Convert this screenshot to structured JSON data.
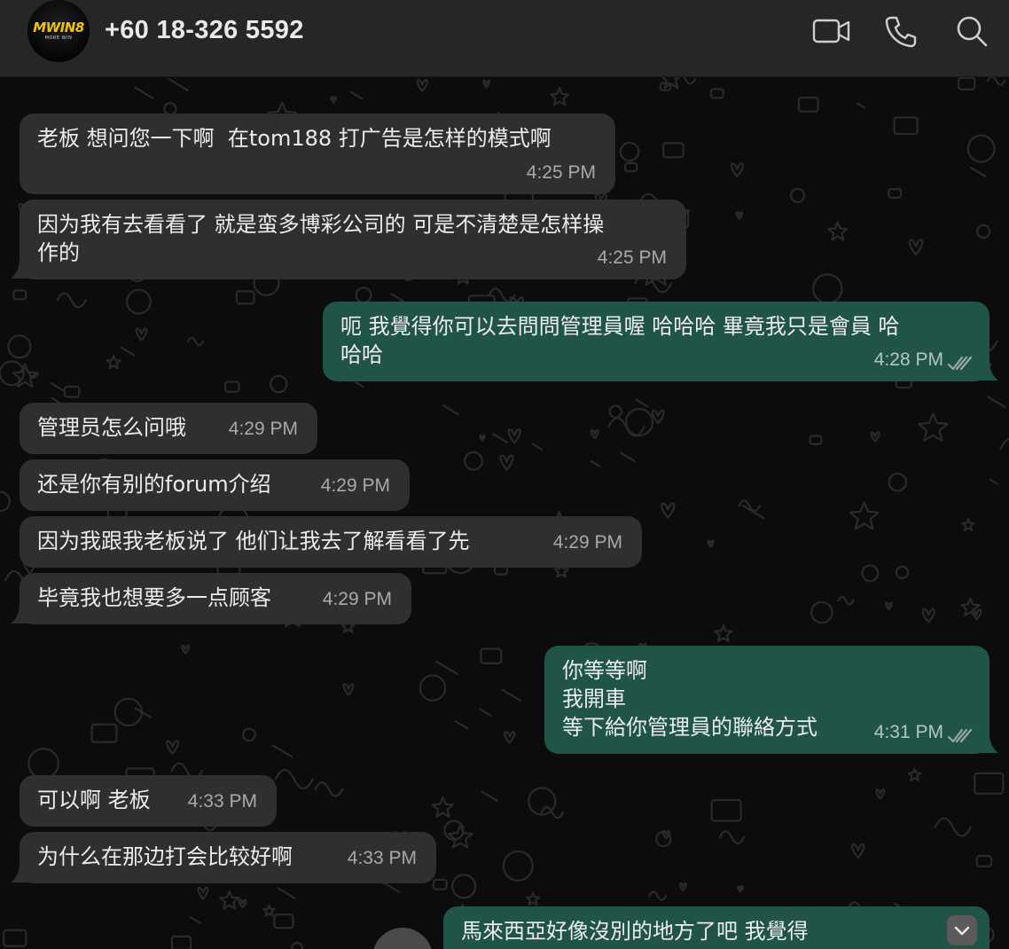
{
  "header": {
    "avatar_logo": "MWIN8",
    "avatar_sub": "MORE WIN",
    "contact_name": "+60 18-326 5592",
    "icons": [
      "video-call-icon",
      "voice-call-icon",
      "search-icon"
    ]
  },
  "colors": {
    "header_bg": "#262626",
    "incoming_bubble": "#2f2f2f",
    "outgoing_bubble": "#1f5447",
    "chat_bg": "#0c0c0c"
  },
  "messages": [
    {
      "dir": "in",
      "text": "老板 想问您一下啊  在tom188 打广告是怎样的模式啊",
      "time": "4:25 PM"
    },
    {
      "dir": "in",
      "text": "因为我有去看看了 就是蛮多博彩公司的 可是不清楚是怎样操\n作的",
      "time": "4:25 PM"
    },
    {
      "dir": "out",
      "text": "呃 我覺得你可以去問問管理員喔 哈哈哈 畢竟我只是會員 哈\n哈哈",
      "time": "4:28 PM",
      "status": "read"
    },
    {
      "dir": "in",
      "text": "管理员怎么问哦",
      "time": "4:29 PM"
    },
    {
      "dir": "in",
      "text": "还是你有别的forum介绍",
      "time": "4:29 PM"
    },
    {
      "dir": "in",
      "text": "因为我跟我老板说了 他们让我去了解看看了先",
      "time": "4:29 PM"
    },
    {
      "dir": "in",
      "text": "毕竟我也想要多一点顾客",
      "time": "4:29 PM"
    },
    {
      "dir": "out",
      "text": "你等等啊\n我開車\n等下給你管理員的聯絡方式",
      "time": "4:31 PM",
      "status": "read"
    },
    {
      "dir": "in",
      "text": "可以啊 老板",
      "time": "4:33 PM"
    },
    {
      "dir": "in",
      "text": "为什么在那边打会比较好啊",
      "time": "4:33 PM"
    },
    {
      "dir": "out",
      "text": "馬來西亞好像沒別的地方了吧 我覺得",
      "time": "",
      "status": ""
    }
  ],
  "scroll_down_icon": "chevron-down-icon"
}
